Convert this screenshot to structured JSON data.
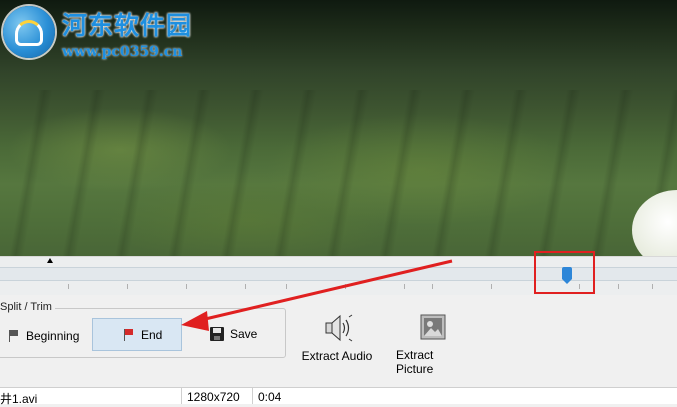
{
  "watermark": {
    "title": "河东软件园",
    "url": "www.pc0359.cn"
  },
  "timeline": {
    "playhead_position": 0.83
  },
  "split_trim": {
    "group_label": "Split / Trim",
    "buttons": [
      {
        "label": "Beginning",
        "icon": "flag-gray-icon"
      },
      {
        "label": "End",
        "icon": "flag-red-icon",
        "selected": true
      },
      {
        "label": "Save",
        "icon": "floppy-disk-icon"
      }
    ]
  },
  "toolbar": {
    "extract_audio_label": "Extract Audio",
    "extract_picture_label": "Extract Picture"
  },
  "file_list": {
    "row": {
      "name": "井1.avi",
      "resolution": "1280x720",
      "duration": "0:04"
    }
  },
  "colors": {
    "annotation_red": "#e02020",
    "accent_blue": "#2d86d8",
    "selected_bg": "#d9e7f3"
  }
}
